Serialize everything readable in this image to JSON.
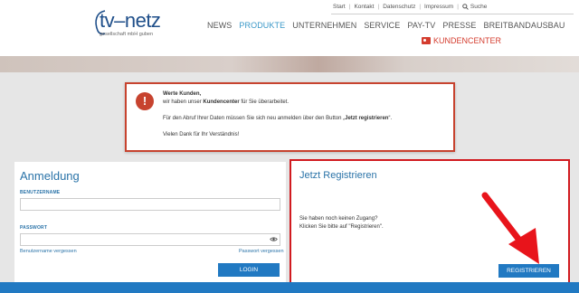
{
  "header": {
    "logo": {
      "main": "tv–netz",
      "sub": "gesellschaft mbH guben"
    },
    "top_nav": [
      "Start",
      "Kontakt",
      "Datenschutz",
      "Impressum"
    ],
    "search_label": "Suche",
    "main_nav": [
      {
        "label": "NEWS",
        "active": false
      },
      {
        "label": "PRODUKTE",
        "active": true
      },
      {
        "label": "UNTERNEHMEN",
        "active": false
      },
      {
        "label": "SERVICE",
        "active": false
      },
      {
        "label": "PAY-TV",
        "active": false
      },
      {
        "label": "PRESSE",
        "active": false
      },
      {
        "label": "BREITBANDAUSBAU",
        "active": false
      }
    ],
    "kundencenter": "KUNDENCENTER"
  },
  "notice": {
    "icon": "!",
    "line1": "Werte Kunden,",
    "line2_pre": "wir haben unser ",
    "line2_bold": "Kundencenter",
    "line2_post": " für Sie überarbeitet.",
    "line3_pre": "Für den Abruf Ihrer Daten müssen Sie sich neu anmelden über den Button „",
    "line3_bold": "Jetzt registrieren",
    "line3_post": "“.",
    "line4": "Vielen Dank für Ihr Verständnis!"
  },
  "login": {
    "title": "Anmeldung",
    "username_label": "BENUTZERNAME",
    "username_value": "",
    "password_label": "PASSWORT",
    "password_value": "",
    "forgot_username": "Benutzername vergessen",
    "forgot_password": "Passwort vergessen",
    "login_button": "LOGIN"
  },
  "register": {
    "title": "Jetzt Registrieren",
    "text_line1": "Sie haben noch keinen Zugang?",
    "text_line2": "Klicken Sie bitte auf \"Registrieren\".",
    "register_button": "REGISTRIEREN"
  },
  "colors": {
    "accent_blue": "#2179c2",
    "title_blue": "#2a73a8",
    "nav_active": "#3a98c8",
    "notice_red": "#c7432f",
    "highlight_red": "#d11a1f",
    "arrow_red": "#e8141b"
  }
}
